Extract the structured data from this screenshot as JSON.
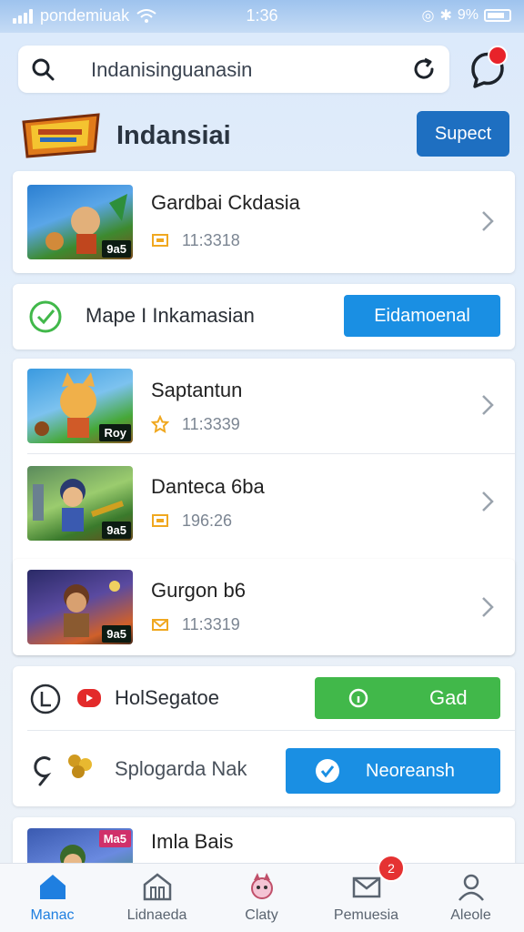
{
  "status_bar": {
    "carrier": "pondemiuak",
    "time": "1:36",
    "battery": "9%"
  },
  "search": {
    "value": "Indanisinguanasin"
  },
  "header": {
    "title": "Indansiai",
    "button_label": "Supect"
  },
  "games_top": {
    "title": "Gardbai Ckdasia",
    "meta": "11:3318",
    "thumb_tag": "9a5"
  },
  "promo": {
    "label": "Mape I Inkamasian",
    "button_label": "Eidamoenal"
  },
  "games": [
    {
      "title": "Saptantun",
      "meta": "11:3339",
      "thumb_tag": "Roy"
    },
    {
      "title": "Danteca 6ba",
      "meta": "196:26",
      "thumb_tag": "9a5"
    },
    {
      "title": "Gurgon b6",
      "meta": "11:3319",
      "thumb_tag": "9a5"
    }
  ],
  "actions": [
    {
      "label": "HolSegatoe",
      "button_label": "Gad"
    },
    {
      "label": "Splogarda Nak",
      "button_label": "Neoreansh"
    }
  ],
  "partial_row": {
    "title": "Imla Bais",
    "thumb_tag": "Ma5"
  },
  "bottom_nav": [
    {
      "label": "Manac",
      "active": true
    },
    {
      "label": "Lidnaeda",
      "active": false
    },
    {
      "label": "Claty",
      "active": false
    },
    {
      "label": "Pemuesia",
      "active": false,
      "badge": "2"
    },
    {
      "label": "Aleole",
      "active": false
    }
  ],
  "colors": {
    "primary": "#1e6fc1",
    "accent_blue": "#1a8fe3",
    "green": "#41b84a",
    "badge_red": "#e53232"
  }
}
